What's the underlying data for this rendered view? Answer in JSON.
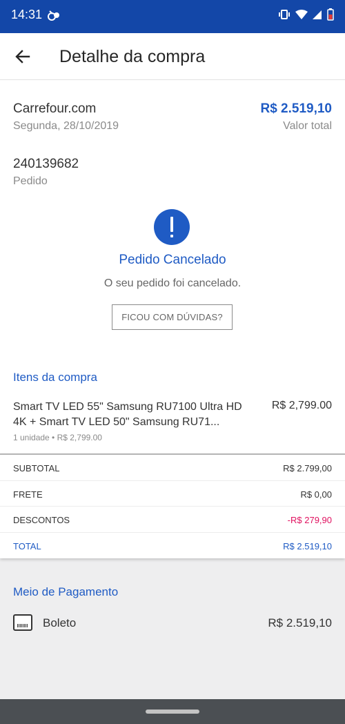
{
  "status_bar": {
    "time": "14:31"
  },
  "app_bar": {
    "title": "Detalhe da compra"
  },
  "purchase": {
    "store": "Carrefour.com",
    "date": "Segunda, 28/10/2019",
    "total": "R$ 2.519,10",
    "total_label": "Valor total",
    "order_number": "240139682",
    "order_label": "Pedido"
  },
  "order_status": {
    "title": "Pedido Cancelado",
    "message": "O seu pedido foi cancelado.",
    "doubts_button": "FICOU COM DÚVIDAS?"
  },
  "items_section": {
    "title": "Itens da compra",
    "items": [
      {
        "name": "Smart TV LED 55\" Samsung RU7100 Ultra HD 4K + Smart TV LED 50\" Samsung RU71...",
        "price": "R$ 2,799.00",
        "detail": "1 unidade • R$ 2,799.00"
      }
    ]
  },
  "summary": {
    "subtotal_label": "SUBTOTAL",
    "subtotal_value": "R$ 2.799,00",
    "shipping_label": "FRETE",
    "shipping_value": "R$ 0,00",
    "discount_label": "DESCONTOS",
    "discount_value": "-R$ 279,90",
    "total_label": "TOTAL",
    "total_value": "R$ 2.519,10"
  },
  "payment": {
    "title": "Meio de Pagamento",
    "method": "Boleto",
    "value": "R$ 2.519,10",
    "icon": "barcode-boleto-icon"
  },
  "colors": {
    "status_bar": "#1347a8",
    "accent": "#1f5bc4",
    "discount": "#e0115f",
    "nav_bar": "#4b4f53"
  }
}
